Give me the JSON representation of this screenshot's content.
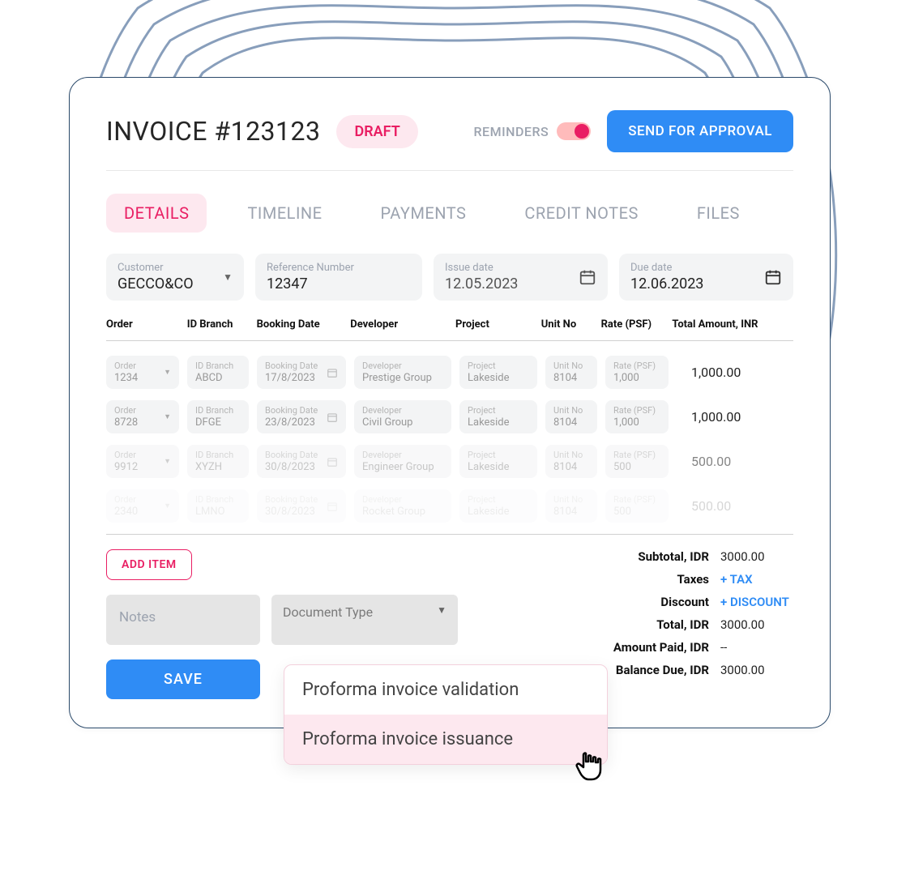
{
  "header": {
    "title": "INVOICE #123123",
    "status_badge": "DRAFT",
    "reminders_label": "REMINDERS",
    "send_button": "SEND FOR APPROVAL"
  },
  "tabs": {
    "details": "DETAILS",
    "timeline": "TIMELINE",
    "payments": "PAYMENTS",
    "credit_notes": "CREDIT NOTES",
    "files": "FILES"
  },
  "fields": {
    "customer_label": "Customer",
    "customer_value": "GECCO&CO",
    "reference_label": "Reference Number",
    "reference_value": "12347",
    "issue_label": "Issue date",
    "issue_value": "12.05.2023",
    "due_label": "Due date",
    "due_value": "12.06.2023"
  },
  "table_headers": {
    "order": "Order",
    "branch": "ID Branch",
    "booking": "Booking Date",
    "developer": "Developer",
    "project": "Project",
    "unit": "Unit No",
    "rate": "Rate (PSF)",
    "total": "Total Amount, INR"
  },
  "rows": [
    {
      "order_label": "Order",
      "order": "1234",
      "branch_label": "ID Branch",
      "branch": "ABCD",
      "date_label": "Booking Date",
      "date": "17/8/2023",
      "dev_label": "Developer",
      "dev": "Prestige Group",
      "proj_label": "Project",
      "proj": "Lakeside",
      "unit_label": "Unit No",
      "unit": "8104",
      "rate_label": "Rate (PSF)",
      "rate": "1,000",
      "amount": "1,000.00"
    },
    {
      "order_label": "Order",
      "order": "8728",
      "branch_label": "ID Branch",
      "branch": "DFGE",
      "date_label": "Booking Date",
      "date": "23/8/2023",
      "dev_label": "Developer",
      "dev": "Civil Group",
      "proj_label": "Project",
      "proj": "Lakeside",
      "unit_label": "Unit No",
      "unit": "8104",
      "rate_label": "Rate (PSF)",
      "rate": "1,000",
      "amount": "1,000.00"
    },
    {
      "order_label": "Order",
      "order": "9912",
      "branch_label": "ID Branch",
      "branch": "XYZH",
      "date_label": "Booking Date",
      "date": "30/8/2023",
      "dev_label": "Developer",
      "dev": "Engineer Group",
      "proj_label": "Project",
      "proj": "Lakeside",
      "unit_label": "Unit No",
      "unit": "8104",
      "rate_label": "Rate (PSF)",
      "rate": "500",
      "amount": "500.00"
    },
    {
      "order_label": "Order",
      "order": "2340",
      "branch_label": "ID Branch",
      "branch": "LMNO",
      "date_label": "Booking Date",
      "date": "30/8/2023",
      "dev_label": "Developer",
      "dev": "Rocket Group",
      "proj_label": "Project",
      "proj": "Lakeside",
      "unit_label": "Unit No",
      "unit": "8104",
      "rate_label": "Rate (PSF)",
      "rate": "500",
      "amount": "500.00"
    }
  ],
  "actions": {
    "add_item": "ADD ITEM",
    "notes_placeholder": "Notes",
    "doc_type_label": "Document Type",
    "save": "SAVE"
  },
  "totals": {
    "subtotal_label": "Subtotal, IDR",
    "subtotal_value": "3000.00",
    "taxes_label": "Taxes",
    "taxes_link": "+ TAX",
    "discount_label": "Discount",
    "discount_link": "+ DISCOUNT",
    "total_label": "Total, IDR",
    "total_value": "3000.00",
    "paid_label": "Amount Paid, IDR",
    "paid_value": "--",
    "balance_label": "Balance Due, IDR",
    "balance_value": "3000.00"
  },
  "dropdown": {
    "option1": "Proforma invoice validation",
    "option2": "Proforma invoice issuance"
  }
}
